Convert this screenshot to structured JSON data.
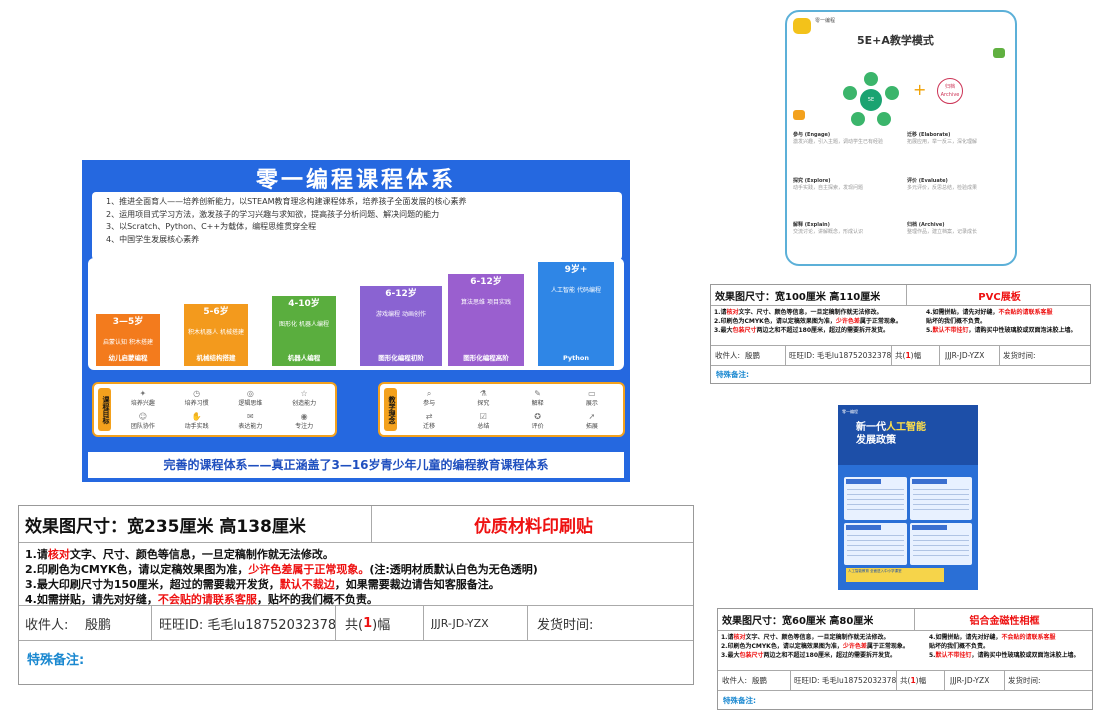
{
  "poster": {
    "title": "零一编程课程体系",
    "goals": [
      "1、推进全面育人——培养创新能力，以STEAM教育理念构建课程体系，培养孩子全面发展的核心素养",
      "2、运用项目式学习方法，激发孩子的学习兴趣与求知欲，提高孩子分析问题、解决问题的能力",
      "3、以Scratch、Python、C++为载体，编程思维贯穿全程",
      "4、中国学生发展核心素养"
    ],
    "steps": [
      {
        "age": "3—5岁",
        "body": "启蒙认知 积木搭建",
        "name": "幼儿启蒙编程"
      },
      {
        "age": "5-6岁",
        "body": "积木机器人 机械搭建",
        "name": "机械结构搭建"
      },
      {
        "age": "4-10岁",
        "body": "图形化 机器人编程",
        "name": "机器人编程"
      },
      {
        "age": "6-12岁",
        "body": "游戏编程 动画创作",
        "name": "图形化编程初阶"
      },
      {
        "age": "6-12岁",
        "body": "算法思维 项目实践",
        "name": "图形化编程高阶"
      },
      {
        "age": "9岁+",
        "body": "人工智能 代码编程",
        "name": "Python"
      }
    ],
    "goals_panel": {
      "tag": "课程目标",
      "items": [
        "培养兴趣",
        "培养习惯",
        "逻辑思维",
        "创造能力",
        "团队协作",
        "动手实践",
        "表达能力",
        "专注力"
      ]
    },
    "method_panel": {
      "tag": "教学理念",
      "items": [
        "参与",
        "探究",
        "解释",
        "展示",
        "迁移",
        "总结",
        "评价",
        "拓展"
      ]
    },
    "footer": "完善的课程体系——真正涵盖了3—16岁青少年儿童的编程教育课程体系"
  },
  "spec_large": {
    "size": "效果图尺寸：宽235厘米  高138厘米",
    "material": "优质材料印刷贴",
    "notes": [
      {
        "a": "1.请",
        "b": "核对",
        "c": "文字、尺寸、颜色等信息，一旦定稿制作就无法修改。",
        "d": "",
        "e": ""
      },
      {
        "a": "2.印刷色为CMYK色，请以定稿效果图为准，",
        "b": "少许色差属于正常现象。",
        "c": "(注:透明材质默认白色为无色透明)",
        "d": "",
        "e": ""
      },
      {
        "a": "3.最大印刷尺寸为150厘米，超过的需要裁开发货，",
        "b": "默认不裁边",
        "c": "，如果需要裁边请告知客服备注。",
        "d": "",
        "e": ""
      },
      {
        "a": "4.如需拼贴，请先对好缝，",
        "b": "不会贴的请联系客服",
        "c": "，贴坏的我们概不负责。",
        "d": "",
        "e": ""
      }
    ],
    "receiver_label": "收件人:",
    "receiver": "殷鹏",
    "wangwang": "旺旺ID: 毛毛lu18752032378",
    "copies_pre": "共(",
    "copies": "1",
    "copies_post": ")幅",
    "code": "JJJR-JD-YZX",
    "ship_label": "发货时间:",
    "remark": "特殊备注:"
  },
  "spec_pvc": {
    "size": "效果图尺寸：宽100厘米  高110厘米",
    "material": "PVC展板",
    "notes_left": [
      {
        "a": "1.请",
        "b": "核对",
        "c": "文字、尺寸、颜色等信息，一旦定稿制作就无法修改。"
      },
      {
        "a": "2.印刷色为CMYK色，请以定稿效果图为准，",
        "b": "少许色差",
        "c": "属于正常现象。"
      },
      {
        "a": "3.最大",
        "b": "包装尺寸",
        "c": "两边之和不超过180厘米，超过的需要拆开发货。"
      }
    ],
    "notes_right": [
      {
        "a": "4.如需拼贴，请先对好缝，",
        "b": "不会贴的请联系客服",
        "c": ""
      },
      {
        "a": "   贴坏的我们概不负责。",
        "b": "",
        "c": ""
      },
      {
        "a": "5.",
        "b": "默认不带挂钉",
        "c": "，请购买中性玻璃胶或双面泡沫胶上墙。"
      }
    ],
    "receiver_label": "收件人:",
    "receiver": "殷鹏",
    "wangwang": "旺旺ID: 毛毛lu18752032378",
    "copies_pre": "共(",
    "copies": "1",
    "copies_post": ")幅",
    "code": "JJJR-JD-YZX",
    "ship_label": "发货时间:",
    "remark": "特殊备注:"
  },
  "spec_alu": {
    "size": "效果图尺寸：宽60厘米  高80厘米",
    "material": "铝合金磁性相框",
    "notes_left": [
      {
        "a": "1.请",
        "b": "核对",
        "c": "文字、尺寸、颜色等信息，一旦定稿制作就无法修改。"
      },
      {
        "a": "2.印刷色为CMYK色，请以定稿效果图为准，",
        "b": "少许色差",
        "c": "属于正常现象。"
      },
      {
        "a": "3.最大",
        "b": "包装尺寸",
        "c": "两边之和不超过180厘米，超过的需要拆开发货。"
      }
    ],
    "notes_right": [
      {
        "a": "4.如需拼贴，请先对好缝，",
        "b": "不会贴的请联系客服",
        "c": ""
      },
      {
        "a": "   贴坏的我们概不负责。",
        "b": "",
        "c": ""
      },
      {
        "a": "5.",
        "b": "默认不带挂钉",
        "c": "，请购买中性玻璃胶或双面泡沫胶上墙。"
      }
    ],
    "receiver_label": "收件人:",
    "receiver": "殷鹏",
    "wangwang": "旺旺ID: 毛毛lu18752032378",
    "copies_pre": "共(",
    "copies": "1",
    "copies_post": ")幅",
    "code": "JJJR-JD-YZX",
    "ship_label": "发货时间:",
    "remark": "特殊备注:"
  },
  "card_5e": {
    "brand": "零一编程",
    "title": "5E+A教学模式",
    "center": "5E",
    "archive_1": "归档",
    "archive_2": "Archive",
    "sections": [
      {
        "h": "参与 (Engage)",
        "t": "激发兴趣，引入主题，调动学生已有经验"
      },
      {
        "h": "探究 (Explore)",
        "t": "动手实践，自主探索，发现问题"
      },
      {
        "h": "解释 (Explain)",
        "t": "交流讨论，讲解概念，形成认识"
      },
      {
        "h": "迁移 (Elaborate)",
        "t": "拓展应用，举一反三，深化理解"
      },
      {
        "h": "评价 (Evaluate)",
        "t": "多元评价，反思总结，检验成果"
      },
      {
        "h": "归档 (Archive)",
        "t": "整理作品，建立档案，记录成长"
      }
    ]
  },
  "ai_poster": {
    "logo": "零一编程",
    "title_1a": "新一代",
    "title_1b": "人工智能",
    "title_2": "发展政策",
    "bar": "人工智能教育 全面进入中小学课堂"
  },
  "colors": {
    "poster_blue": "#2568e0",
    "step_orange": "#f37b1d",
    "step_orange2": "#f39a1d",
    "step_green": "#5aae3e",
    "step_purple": "#8a63d2",
    "step_purple2": "#9a5fcf",
    "step_blue": "#2f86e6",
    "accent_red": "#e11111",
    "remark_blue": "#1a88d0"
  }
}
